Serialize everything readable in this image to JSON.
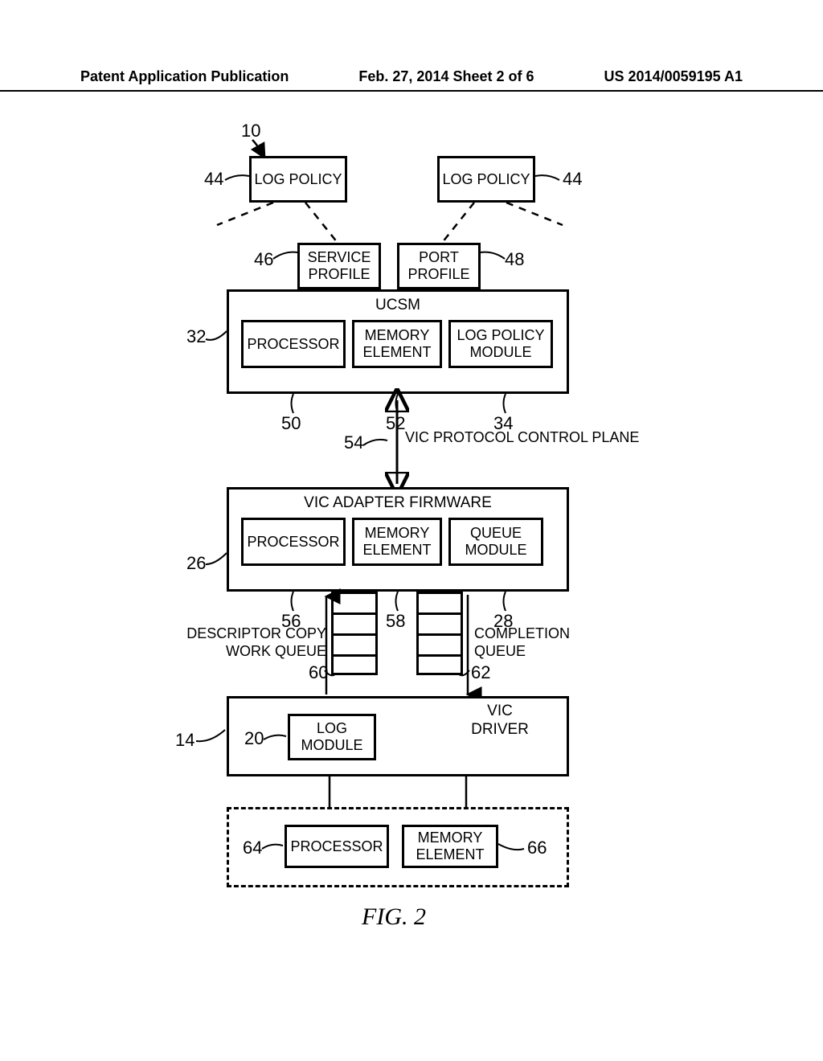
{
  "header": {
    "left": "Patent Application Publication",
    "center": "Feb. 27, 2014  Sheet 2 of 6",
    "right": "US 2014/0059195 A1"
  },
  "refs": {
    "r10": "10",
    "r44a": "44",
    "r44b": "44",
    "r46": "46",
    "r48": "48",
    "r32": "32",
    "r50": "50",
    "r52": "52",
    "r34": "34",
    "r54": "54",
    "r26": "26",
    "r56": "56",
    "r58": "58",
    "r28": "28",
    "r60": "60",
    "r62": "62",
    "r14": "14",
    "r20": "20",
    "r64": "64",
    "r66": "66"
  },
  "boxes": {
    "log_policy_a": "LOG POLICY",
    "log_policy_b": "LOG POLICY",
    "service_profile": "SERVICE PROFILE",
    "port_profile": "PORT PROFILE",
    "ucsm_title": "UCSM",
    "processor_1": "PROCESSOR",
    "memory_el_1": "MEMORY ELEMENT",
    "log_policy_module": "LOG POLICY MODULE",
    "vic_protocol": "VIC PROTOCOL CONTROL PLANE",
    "vic_firmware_title": "VIC ADAPTER FIRMWARE",
    "processor_2": "PROCESSOR",
    "memory_el_2": "MEMORY ELEMENT",
    "queue_module": "QUEUE MODULE",
    "descriptor_queue": "DESCRIPTOR COPY WORK QUEUE",
    "completion_queue": "COMPLETION QUEUE",
    "log_module": "LOG MODULE",
    "vic_driver": "VIC DRIVER",
    "processor_3": "PROCESSOR",
    "memory_el_3": "MEMORY ELEMENT"
  },
  "figure_caption": "FIG. 2"
}
